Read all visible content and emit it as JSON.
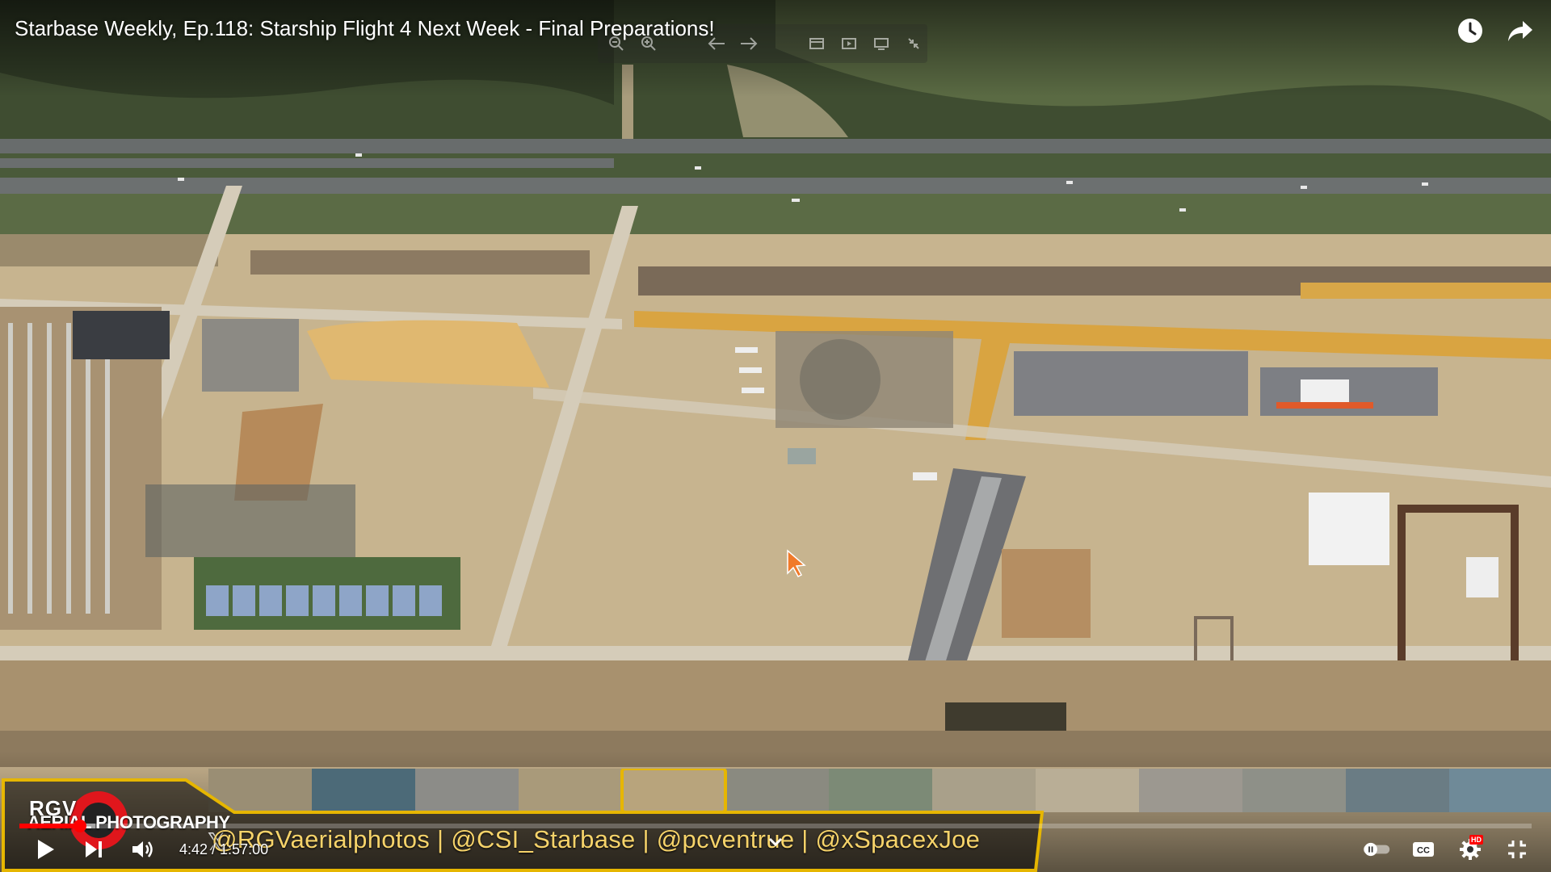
{
  "video": {
    "title": "Starbase Weekly, Ep.118: Starship Flight 4 Next Week - Final Preparations!"
  },
  "top_actions": [
    {
      "name": "watch-later",
      "icon": "clock-icon"
    },
    {
      "name": "share",
      "icon": "share-icon"
    }
  ],
  "viewer_toolbar": {
    "icons": [
      "zoom-out-icon",
      "zoom-in-icon",
      "arrow-left-icon",
      "arrow-right-icon",
      "window-icon",
      "play-box-icon",
      "monitor-icon",
      "collapse-icon"
    ]
  },
  "banner": {
    "logo_line1": "RGV",
    "logo_line2": "AERIAL PHOTOGRAPHY",
    "x_glyph": "𝕏",
    "social_handles": "@RGVaerialphotos | @CSI_Starbase | @pcventrue | @xSpacexJoe",
    "colors": {
      "border": "#e6b600",
      "text": "#f6d36a",
      "logo_red": "#e0161c"
    }
  },
  "player": {
    "current_time": "4:42",
    "duration": "1:57:00",
    "time_display": "4:42 / 1:57:00",
    "progress": 0.04,
    "buffered": 0.05,
    "progress_color": "#ff0000",
    "quality_badge": "HD"
  }
}
